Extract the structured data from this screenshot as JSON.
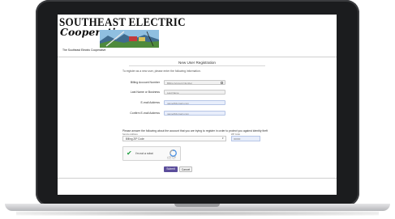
{
  "brand": {
    "name_line1": "SOUTHEAST ELECTRIC",
    "name_line2": "Cooperative",
    "tagline": "The Southeast Electric Cooperative"
  },
  "page": {
    "title": "New User Registration",
    "intro": "To register as a new user, please enter the following information."
  },
  "form": {
    "fields": [
      {
        "label": "Billing Account Number",
        "value": "Billing Account Number"
      },
      {
        "label": "Last Name or Business",
        "value": "Last Name"
      },
      {
        "label": "E-mail Address",
        "value": "name@domain.com"
      },
      {
        "label": "Confirm E-mail Address",
        "value": "name@domain.com"
      }
    ],
    "question": "Please answer the following about the account that you are trying to register in order to protect you against identity theft",
    "select_label": "Service Address",
    "select_value": "Billing ZIP Code",
    "small_label": "ZIP Code",
    "small_value": "00000"
  },
  "captcha": {
    "label": "I'm not a robot",
    "brand": "reCAPTCHA",
    "sub": "Privacy - Terms"
  },
  "buttons": {
    "submit": "Submit",
    "cancel": "Cancel"
  },
  "colors": {
    "accent": "#5b4d9b",
    "captcha_check": "#1e9e3f"
  }
}
